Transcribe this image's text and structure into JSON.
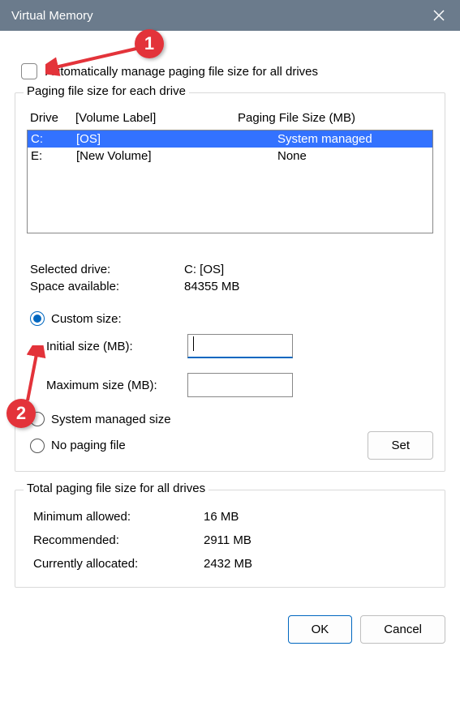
{
  "window": {
    "title": "Virtual Memory"
  },
  "auto_checkbox": {
    "label": "Automatically manage paging file size for all drives",
    "checked": false
  },
  "drives_group": {
    "title": "Paging file size for each drive",
    "header_drive": "Drive",
    "header_label": "[Volume Label]",
    "header_size": "Paging File Size (MB)",
    "rows": [
      {
        "drive": "C:",
        "label": "[OS]",
        "size": "System managed",
        "selected": true
      },
      {
        "drive": "E:",
        "label": "[New Volume]",
        "size": "None",
        "selected": false
      }
    ]
  },
  "selected_info": {
    "drive_label": "Selected drive:",
    "drive_value": "C:  [OS]",
    "space_label": "Space available:",
    "space_value": "84355 MB"
  },
  "size_options": {
    "custom_label": "Custom size:",
    "initial_label": "Initial size (MB):",
    "initial_value": "",
    "maximum_label": "Maximum size (MB):",
    "maximum_value": "",
    "system_managed_label": "System managed size",
    "no_paging_label": "No paging file",
    "set_label": "Set",
    "selected_radio": "custom"
  },
  "totals_group": {
    "title": "Total paging file size for all drives",
    "min_label": "Minimum allowed:",
    "min_value": "16 MB",
    "rec_label": "Recommended:",
    "rec_value": "2911 MB",
    "cur_label": "Currently allocated:",
    "cur_value": "2432 MB"
  },
  "buttons": {
    "ok": "OK",
    "cancel": "Cancel"
  },
  "annotations": {
    "one": "1",
    "two": "2"
  }
}
